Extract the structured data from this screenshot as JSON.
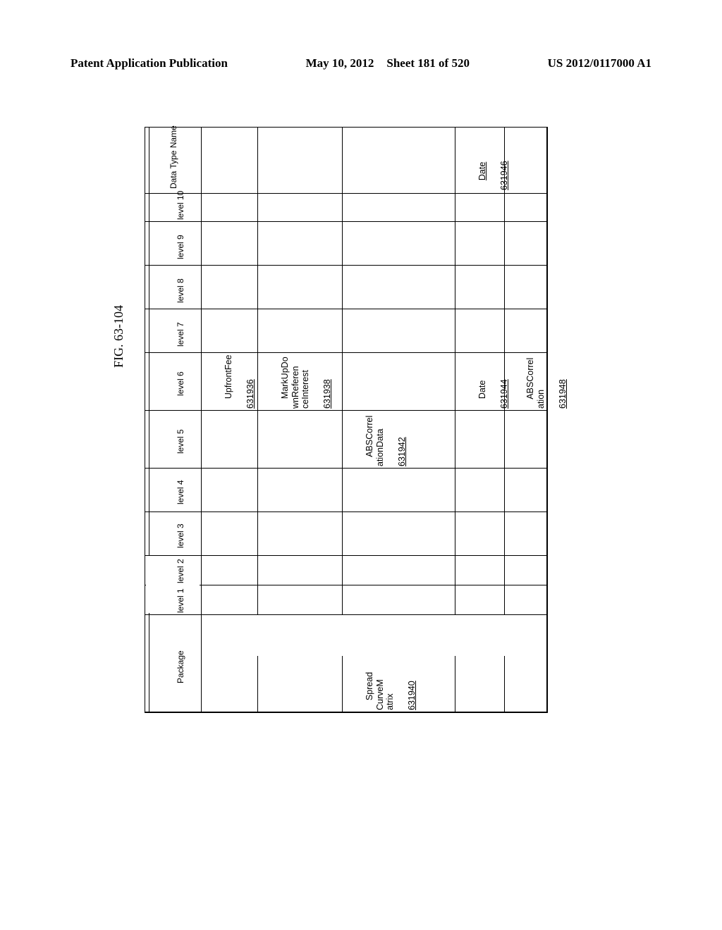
{
  "header": {
    "left": "Patent Application Publication",
    "date": "May 10, 2012",
    "sheet": "Sheet 181 of 520",
    "pubno": "US 2012/0117000 A1"
  },
  "figure_label": "FIG. 63-104",
  "columns": [
    "Package",
    "level 1",
    "level 2",
    "level 3",
    "level 4",
    "level 5",
    "level 6",
    "level 7",
    "level 8",
    "level 9",
    "level 10",
    "Data Type Name"
  ],
  "rows": [
    {
      "package": "",
      "levels": [
        "",
        "",
        "",
        "",
        "",
        "UpfrontFee",
        "",
        "",
        "",
        ""
      ],
      "datatype": "",
      "ref": "631936",
      "ref_col": 6
    },
    {
      "package": "",
      "levels": [
        "",
        "",
        "",
        "",
        "",
        "MarkUpDo\nwnReferen\nceInterest",
        "",
        "",
        "",
        ""
      ],
      "datatype": "",
      "ref": "631938",
      "ref_col": 6
    },
    {
      "package": "Spread\nCurveM\natrix",
      "levels": [
        "",
        "",
        "",
        "",
        "ABSCorrel\nationData",
        "",
        "",
        "",
        "",
        ""
      ],
      "datatype": "",
      "ref_pkg": "631940",
      "ref": "631942",
      "ref_col": 5
    },
    {
      "package": "",
      "levels": [
        "",
        "",
        "",
        "",
        "",
        "Date",
        "",
        "",
        "",
        ""
      ],
      "datatype": "Date",
      "ref": "631944",
      "ref_dt": "631946",
      "ref_col": 6
    },
    {
      "package": "",
      "levels": [
        "",
        "",
        "",
        "",
        "",
        "ABSCorrel\nation",
        "",
        "",
        "",
        ""
      ],
      "datatype": "",
      "ref": "631948",
      "ref_col": 6
    }
  ]
}
